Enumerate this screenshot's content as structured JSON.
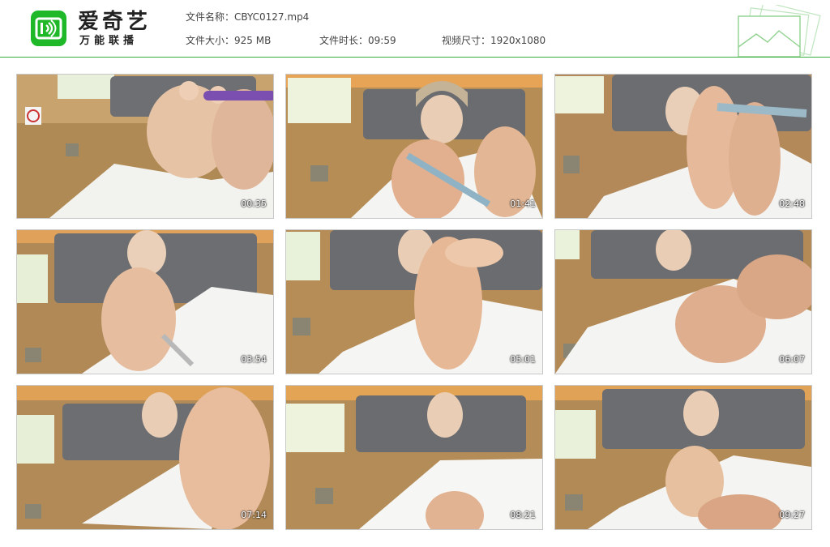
{
  "brand": {
    "name": "爱奇艺",
    "subtitle": "万能联播",
    "accent": "#1fb829"
  },
  "file_info": {
    "name_label": "文件名称：",
    "name_value": "CBYC0127.mp4",
    "size_label": "文件大小：",
    "size_value": "925 MB",
    "duration_label": "文件时长：",
    "duration_value": "09:59",
    "dimension_label": "视频尺寸：",
    "dimension_value": "1920x1080"
  },
  "thumbnails": [
    {
      "timestamp": "00:35"
    },
    {
      "timestamp": "01:41"
    },
    {
      "timestamp": "02:48"
    },
    {
      "timestamp": "03:54"
    },
    {
      "timestamp": "05:01"
    },
    {
      "timestamp": "06:07"
    },
    {
      "timestamp": "07:14"
    },
    {
      "timestamp": "08:21"
    },
    {
      "timestamp": "09:27"
    }
  ]
}
